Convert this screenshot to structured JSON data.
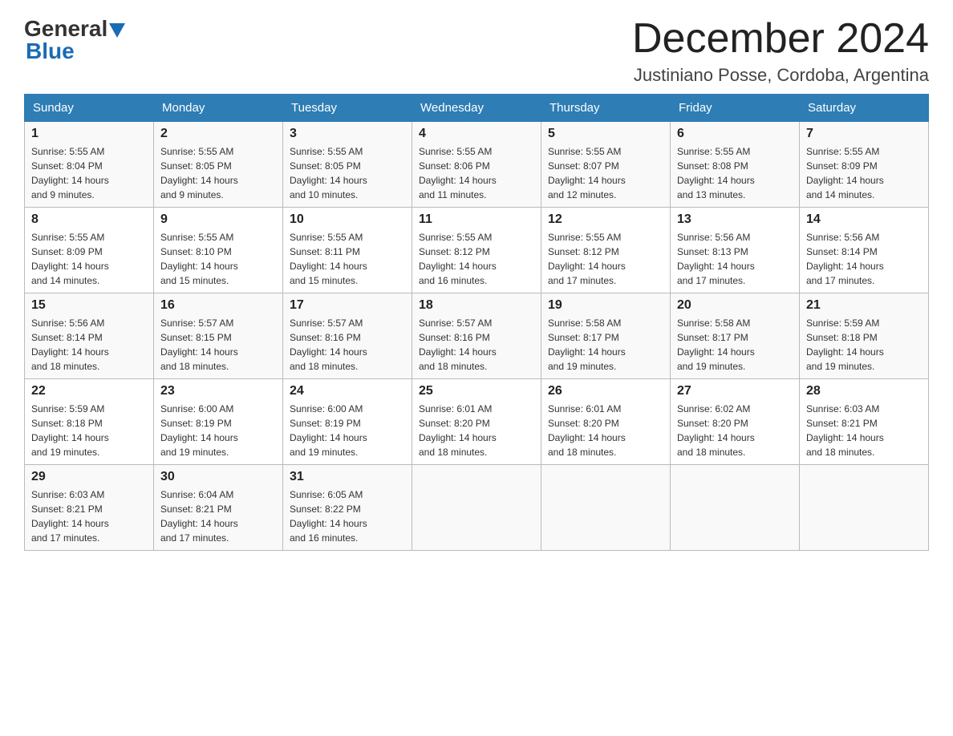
{
  "header": {
    "logo_general": "General",
    "logo_blue": "Blue",
    "month_title": "December 2024",
    "location": "Justiniano Posse, Cordoba, Argentina"
  },
  "weekdays": [
    "Sunday",
    "Monday",
    "Tuesday",
    "Wednesday",
    "Thursday",
    "Friday",
    "Saturday"
  ],
  "weeks": [
    [
      {
        "day": "1",
        "sunrise": "5:55 AM",
        "sunset": "8:04 PM",
        "daylight": "14 hours and 9 minutes."
      },
      {
        "day": "2",
        "sunrise": "5:55 AM",
        "sunset": "8:05 PM",
        "daylight": "14 hours and 9 minutes."
      },
      {
        "day": "3",
        "sunrise": "5:55 AM",
        "sunset": "8:05 PM",
        "daylight": "14 hours and 10 minutes."
      },
      {
        "day": "4",
        "sunrise": "5:55 AM",
        "sunset": "8:06 PM",
        "daylight": "14 hours and 11 minutes."
      },
      {
        "day": "5",
        "sunrise": "5:55 AM",
        "sunset": "8:07 PM",
        "daylight": "14 hours and 12 minutes."
      },
      {
        "day": "6",
        "sunrise": "5:55 AM",
        "sunset": "8:08 PM",
        "daylight": "14 hours and 13 minutes."
      },
      {
        "day": "7",
        "sunrise": "5:55 AM",
        "sunset": "8:09 PM",
        "daylight": "14 hours and 14 minutes."
      }
    ],
    [
      {
        "day": "8",
        "sunrise": "5:55 AM",
        "sunset": "8:09 PM",
        "daylight": "14 hours and 14 minutes."
      },
      {
        "day": "9",
        "sunrise": "5:55 AM",
        "sunset": "8:10 PM",
        "daylight": "14 hours and 15 minutes."
      },
      {
        "day": "10",
        "sunrise": "5:55 AM",
        "sunset": "8:11 PM",
        "daylight": "14 hours and 15 minutes."
      },
      {
        "day": "11",
        "sunrise": "5:55 AM",
        "sunset": "8:12 PM",
        "daylight": "14 hours and 16 minutes."
      },
      {
        "day": "12",
        "sunrise": "5:55 AM",
        "sunset": "8:12 PM",
        "daylight": "14 hours and 17 minutes."
      },
      {
        "day": "13",
        "sunrise": "5:56 AM",
        "sunset": "8:13 PM",
        "daylight": "14 hours and 17 minutes."
      },
      {
        "day": "14",
        "sunrise": "5:56 AM",
        "sunset": "8:14 PM",
        "daylight": "14 hours and 17 minutes."
      }
    ],
    [
      {
        "day": "15",
        "sunrise": "5:56 AM",
        "sunset": "8:14 PM",
        "daylight": "14 hours and 18 minutes."
      },
      {
        "day": "16",
        "sunrise": "5:57 AM",
        "sunset": "8:15 PM",
        "daylight": "14 hours and 18 minutes."
      },
      {
        "day": "17",
        "sunrise": "5:57 AM",
        "sunset": "8:16 PM",
        "daylight": "14 hours and 18 minutes."
      },
      {
        "day": "18",
        "sunrise": "5:57 AM",
        "sunset": "8:16 PM",
        "daylight": "14 hours and 18 minutes."
      },
      {
        "day": "19",
        "sunrise": "5:58 AM",
        "sunset": "8:17 PM",
        "daylight": "14 hours and 19 minutes."
      },
      {
        "day": "20",
        "sunrise": "5:58 AM",
        "sunset": "8:17 PM",
        "daylight": "14 hours and 19 minutes."
      },
      {
        "day": "21",
        "sunrise": "5:59 AM",
        "sunset": "8:18 PM",
        "daylight": "14 hours and 19 minutes."
      }
    ],
    [
      {
        "day": "22",
        "sunrise": "5:59 AM",
        "sunset": "8:18 PM",
        "daylight": "14 hours and 19 minutes."
      },
      {
        "day": "23",
        "sunrise": "6:00 AM",
        "sunset": "8:19 PM",
        "daylight": "14 hours and 19 minutes."
      },
      {
        "day": "24",
        "sunrise": "6:00 AM",
        "sunset": "8:19 PM",
        "daylight": "14 hours and 19 minutes."
      },
      {
        "day": "25",
        "sunrise": "6:01 AM",
        "sunset": "8:20 PM",
        "daylight": "14 hours and 18 minutes."
      },
      {
        "day": "26",
        "sunrise": "6:01 AM",
        "sunset": "8:20 PM",
        "daylight": "14 hours and 18 minutes."
      },
      {
        "day": "27",
        "sunrise": "6:02 AM",
        "sunset": "8:20 PM",
        "daylight": "14 hours and 18 minutes."
      },
      {
        "day": "28",
        "sunrise": "6:03 AM",
        "sunset": "8:21 PM",
        "daylight": "14 hours and 18 minutes."
      }
    ],
    [
      {
        "day": "29",
        "sunrise": "6:03 AM",
        "sunset": "8:21 PM",
        "daylight": "14 hours and 17 minutes."
      },
      {
        "day": "30",
        "sunrise": "6:04 AM",
        "sunset": "8:21 PM",
        "daylight": "14 hours and 17 minutes."
      },
      {
        "day": "31",
        "sunrise": "6:05 AM",
        "sunset": "8:22 PM",
        "daylight": "14 hours and 16 minutes."
      },
      null,
      null,
      null,
      null
    ]
  ],
  "labels": {
    "sunrise": "Sunrise:",
    "sunset": "Sunset:",
    "daylight": "Daylight:"
  }
}
